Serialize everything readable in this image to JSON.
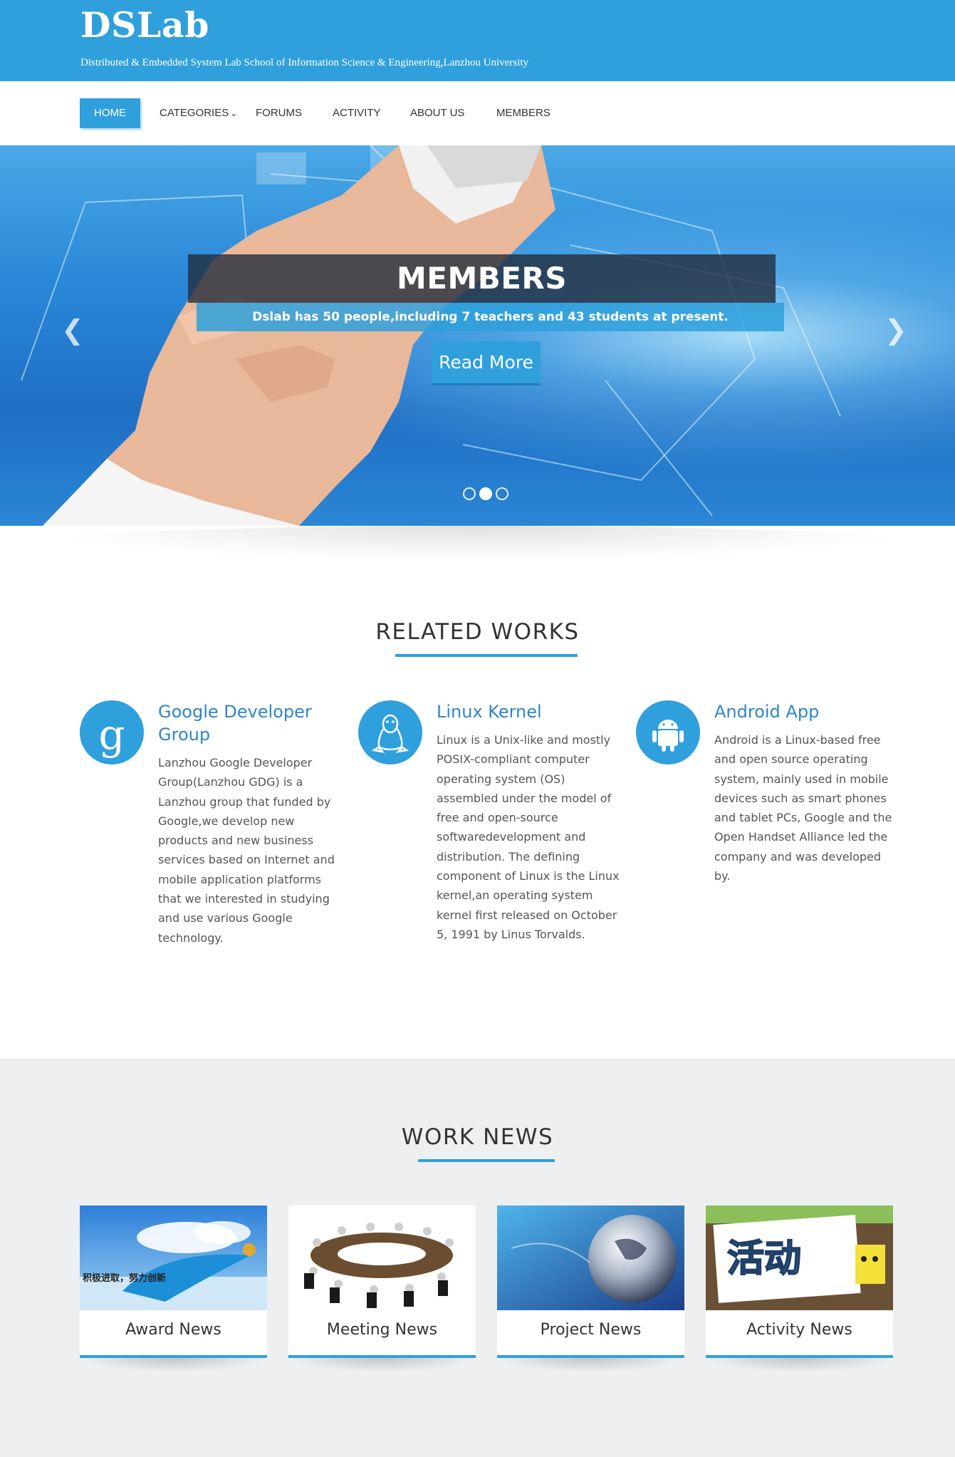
{
  "header": {
    "brand": "DSLab",
    "tagline": "Distributed & Embedded System Lab School of Information Science & Engineering,Lanzhou University"
  },
  "nav": {
    "items": [
      {
        "label": "HOME",
        "active": true
      },
      {
        "label": "CATEGORIES",
        "dropdown": true
      },
      {
        "label": "FORUMS"
      },
      {
        "label": "ACTIVITY"
      },
      {
        "label": "ABOUT US"
      },
      {
        "label": "MEMBERS"
      }
    ]
  },
  "hero": {
    "title": "MEMBERS",
    "subtitle": "Dslab has 50 people,including 7 teachers and 43 students at present.",
    "button": "Read More",
    "prev_icon": "chevron-left-icon",
    "next_icon": "chevron-right-icon",
    "slide_count": 3,
    "active_slide": 2
  },
  "related_works": {
    "heading": "RELATED WORKS",
    "items": [
      {
        "icon": "google-g-icon",
        "title": "Google Developer Group",
        "description": "Lanzhou Google Developer Group(Lanzhou GDG) is a Lanzhou group that funded by Google,we develop new products and new business services based on Internet and mobile application platforms that we interested in studying and use various Google technology."
      },
      {
        "icon": "linux-penguin-icon",
        "title": "Linux Kernel",
        "description": "Linux is a Unix-like and mostly POSIX-compliant computer operating system (OS) assembled under the model of free and open-source softwaredevelopment and distribution. The defining component of Linux is the Linux kernel,an operating system kernel first released on October 5, 1991 by Linus Torvalds."
      },
      {
        "icon": "android-icon",
        "title": "Android App",
        "description": "Android is a Linux-based free and open source operating system, mainly used in mobile devices such as smart phones and tablet PCs, Google and the Open Handset Alliance led the company and was developed by."
      }
    ]
  },
  "work_news": {
    "heading": "WORK NEWS",
    "cards": [
      {
        "label": "Award News",
        "image_text": "积极进取，努力创新"
      },
      {
        "label": "Meeting News"
      },
      {
        "label": "Project News"
      },
      {
        "label": "Activity News",
        "image_text": "活动"
      }
    ]
  },
  "colors": {
    "brand_blue": "#2fa0dc",
    "title_blue": "#2f86c7",
    "news_bg": "#edeff0"
  }
}
